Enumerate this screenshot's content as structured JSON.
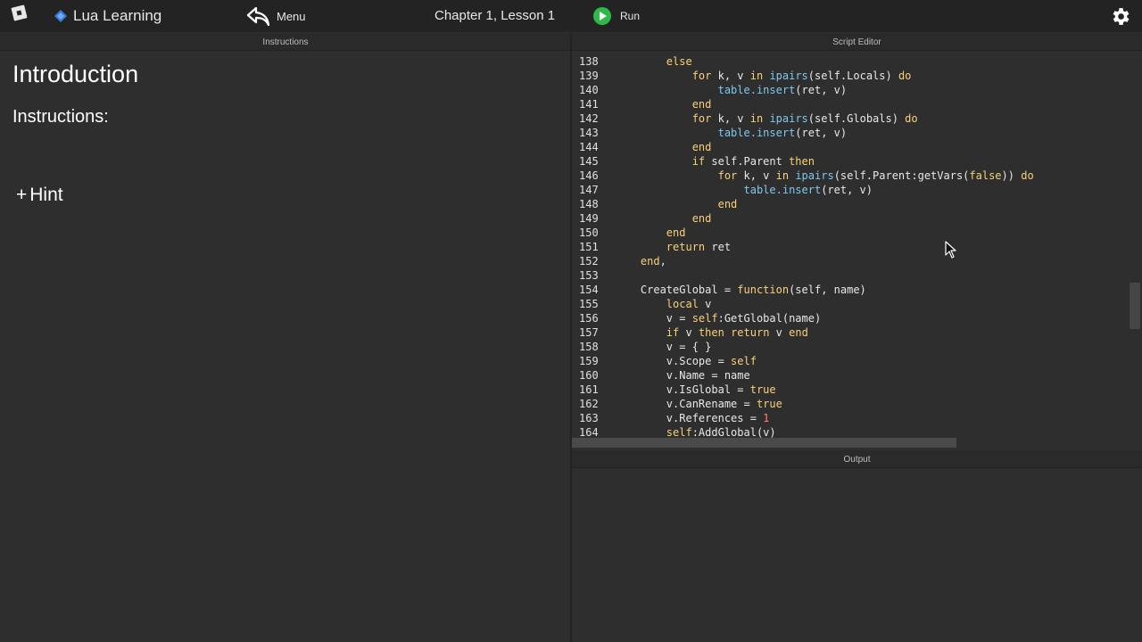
{
  "topbar": {
    "app_title": "Lua Learning",
    "menu_label": "Menu",
    "lesson_title": "Chapter 1, Lesson 1",
    "run_label": "Run",
    "icons": {
      "logo": "roblox-logo-icon",
      "app": "lua-learning-icon",
      "menu": "back-arrow-icon",
      "run": "play-icon",
      "settings": "gear-icon"
    }
  },
  "panels": {
    "instructions_header": "Instructions",
    "editor_header": "Script Editor",
    "output_header": "Output"
  },
  "instructions": {
    "title": "Introduction",
    "label": "Instructions:",
    "hint_plus": "+",
    "hint_label": "Hint"
  },
  "editor": {
    "lines": [
      {
        "num": "138",
        "segments": [
          {
            "t": "        "
          },
          {
            "t": "else",
            "c": "kw"
          }
        ]
      },
      {
        "num": "139",
        "segments": [
          {
            "t": "            "
          },
          {
            "t": "for",
            "c": "kw"
          },
          {
            "t": " k, v "
          },
          {
            "t": "in",
            "c": "kw"
          },
          {
            "t": " "
          },
          {
            "t": "ipairs",
            "c": "fn"
          },
          {
            "t": "(self.Locals) "
          },
          {
            "t": "do",
            "c": "kw"
          }
        ]
      },
      {
        "num": "140",
        "segments": [
          {
            "t": "                "
          },
          {
            "t": "table.insert",
            "c": "fn"
          },
          {
            "t": "(ret, v)"
          }
        ]
      },
      {
        "num": "141",
        "segments": [
          {
            "t": "            "
          },
          {
            "t": "end",
            "c": "kw"
          }
        ]
      },
      {
        "num": "142",
        "segments": [
          {
            "t": "            "
          },
          {
            "t": "for",
            "c": "kw"
          },
          {
            "t": " k, v "
          },
          {
            "t": "in",
            "c": "kw"
          },
          {
            "t": " "
          },
          {
            "t": "ipairs",
            "c": "fn"
          },
          {
            "t": "(self.Globals) "
          },
          {
            "t": "do",
            "c": "kw"
          }
        ]
      },
      {
        "num": "143",
        "segments": [
          {
            "t": "                "
          },
          {
            "t": "table.insert",
            "c": "fn"
          },
          {
            "t": "(ret, v)"
          }
        ]
      },
      {
        "num": "144",
        "segments": [
          {
            "t": "            "
          },
          {
            "t": "end",
            "c": "kw"
          }
        ]
      },
      {
        "num": "145",
        "segments": [
          {
            "t": "            "
          },
          {
            "t": "if",
            "c": "kw"
          },
          {
            "t": " self.Parent "
          },
          {
            "t": "then",
            "c": "kw"
          }
        ]
      },
      {
        "num": "146",
        "segments": [
          {
            "t": "                "
          },
          {
            "t": "for",
            "c": "kw"
          },
          {
            "t": " k, v "
          },
          {
            "t": "in",
            "c": "kw"
          },
          {
            "t": " "
          },
          {
            "t": "ipairs",
            "c": "fn"
          },
          {
            "t": "(self.Parent:getVars("
          },
          {
            "t": "false",
            "c": "bool"
          },
          {
            "t": ")) "
          },
          {
            "t": "do",
            "c": "kw"
          }
        ]
      },
      {
        "num": "147",
        "segments": [
          {
            "t": "                    "
          },
          {
            "t": "table.insert",
            "c": "fn"
          },
          {
            "t": "(ret, v)"
          }
        ]
      },
      {
        "num": "148",
        "segments": [
          {
            "t": "                "
          },
          {
            "t": "end",
            "c": "kw"
          }
        ]
      },
      {
        "num": "149",
        "segments": [
          {
            "t": "            "
          },
          {
            "t": "end",
            "c": "kw"
          }
        ]
      },
      {
        "num": "150",
        "segments": [
          {
            "t": "        "
          },
          {
            "t": "end",
            "c": "kw"
          }
        ]
      },
      {
        "num": "151",
        "segments": [
          {
            "t": "        "
          },
          {
            "t": "return",
            "c": "kw"
          },
          {
            "t": " ret"
          }
        ]
      },
      {
        "num": "152",
        "segments": [
          {
            "t": "    "
          },
          {
            "t": "end",
            "c": "kw"
          },
          {
            "t": ","
          }
        ]
      },
      {
        "num": "153",
        "segments": []
      },
      {
        "num": "154",
        "segments": [
          {
            "t": "    CreateGlobal = "
          },
          {
            "t": "function",
            "c": "kw"
          },
          {
            "t": "(self, name)"
          }
        ]
      },
      {
        "num": "155",
        "segments": [
          {
            "t": "        "
          },
          {
            "t": "local",
            "c": "kw"
          },
          {
            "t": " v"
          }
        ]
      },
      {
        "num": "156",
        "segments": [
          {
            "t": "        v = "
          },
          {
            "t": "self",
            "c": "kw"
          },
          {
            "t": ":GetGlobal(name)"
          }
        ]
      },
      {
        "num": "157",
        "segments": [
          {
            "t": "        "
          },
          {
            "t": "if",
            "c": "kw"
          },
          {
            "t": " v "
          },
          {
            "t": "then",
            "c": "kw"
          },
          {
            "t": " "
          },
          {
            "t": "return",
            "c": "kw"
          },
          {
            "t": " v "
          },
          {
            "t": "end",
            "c": "kw"
          }
        ]
      },
      {
        "num": "158",
        "segments": [
          {
            "t": "        v = { }"
          }
        ]
      },
      {
        "num": "159",
        "segments": [
          {
            "t": "        v.Scope = "
          },
          {
            "t": "self",
            "c": "kw"
          }
        ]
      },
      {
        "num": "160",
        "segments": [
          {
            "t": "        v.Name = name"
          }
        ]
      },
      {
        "num": "161",
        "segments": [
          {
            "t": "        v.IsGlobal = "
          },
          {
            "t": "true",
            "c": "bool"
          }
        ]
      },
      {
        "num": "162",
        "segments": [
          {
            "t": "        v.CanRename = "
          },
          {
            "t": "true",
            "c": "bool"
          }
        ]
      },
      {
        "num": "163",
        "segments": [
          {
            "t": "        v.References = "
          },
          {
            "t": "1",
            "c": "num"
          }
        ]
      },
      {
        "num": "164",
        "segments": [
          {
            "t": "        "
          },
          {
            "t": "self",
            "c": "kw"
          },
          {
            "t": ":AddGlobal(v)"
          }
        ]
      }
    ]
  },
  "output": {
    "lines": []
  }
}
